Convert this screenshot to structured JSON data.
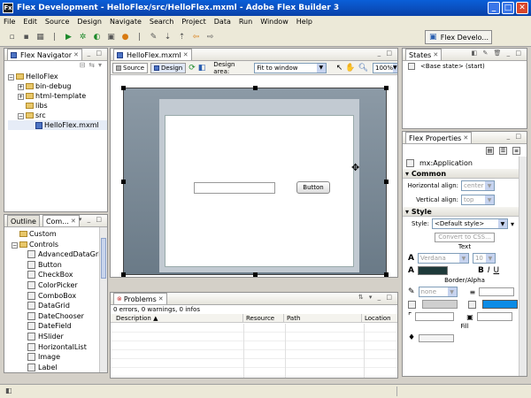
{
  "window": {
    "title": "Flex Development - HelloFlex/src/HelloFlex.mxml - Adobe Flex Builder 3",
    "min": "_",
    "max": "□",
    "close": "✕"
  },
  "menu": [
    "File",
    "Edit",
    "Source",
    "Design",
    "Navigate",
    "Search",
    "Project",
    "Data",
    "Run",
    "Window",
    "Help"
  ],
  "perspective": {
    "label": "Flex Develo..."
  },
  "navigator": {
    "tab": "Flex Navigator",
    "tree": [
      {
        "label": "HelloFlex",
        "indent": 0,
        "exp": "−",
        "kind": "folder"
      },
      {
        "label": "bin-debug",
        "indent": 1,
        "exp": "+",
        "kind": "folder"
      },
      {
        "label": "html-template",
        "indent": 1,
        "exp": "+",
        "kind": "folder"
      },
      {
        "label": "libs",
        "indent": 1,
        "exp": "",
        "kind": "folder"
      },
      {
        "label": "src",
        "indent": 1,
        "exp": "−",
        "kind": "folder"
      },
      {
        "label": "HelloFlex.mxml",
        "indent": 2,
        "exp": "",
        "kind": "file"
      }
    ]
  },
  "components": {
    "tabs": [
      "Outline",
      "Com..."
    ],
    "items": [
      {
        "label": "Custom",
        "kind": "folder",
        "indent": 0,
        "exp": ""
      },
      {
        "label": "Controls",
        "kind": "folder",
        "indent": 0,
        "exp": "−"
      },
      {
        "label": "AdvancedDataGrid",
        "indent": 1
      },
      {
        "label": "Button",
        "indent": 1
      },
      {
        "label": "CheckBox",
        "indent": 1
      },
      {
        "label": "ColorPicker",
        "indent": 1
      },
      {
        "label": "ComboBox",
        "indent": 1
      },
      {
        "label": "DataGrid",
        "indent": 1
      },
      {
        "label": "DateChooser",
        "indent": 1
      },
      {
        "label": "DateField",
        "indent": 1
      },
      {
        "label": "HSlider",
        "indent": 1
      },
      {
        "label": "HorizontalList",
        "indent": 1
      },
      {
        "label": "Image",
        "indent": 1
      },
      {
        "label": "Label",
        "indent": 1
      }
    ]
  },
  "editor": {
    "tab": "HelloFlex.mxml",
    "source_label": "Source",
    "design_label": "Design",
    "design_area_label": "Design area:",
    "design_area_value": "Fit to window",
    "zoom": "100%",
    "canvas_button": "Button"
  },
  "problems": {
    "tab": "Problems",
    "summary": "0 errors, 0 warnings, 0 infos",
    "columns": [
      "Description",
      "Resource",
      "Path",
      "Location"
    ]
  },
  "states": {
    "tab": "States",
    "item": "<Base state> (start)"
  },
  "properties": {
    "tab": "Flex Properties",
    "component": "mx:Application",
    "common_title": "Common",
    "halign_label": "Horizontal align:",
    "halign_value": "center",
    "valign_label": "Vertical align:",
    "valign_value": "top",
    "style_title": "Style",
    "style_label": "Style:",
    "style_value": "<Default style>",
    "convert_label": "Convert to CSS...",
    "text_title": "Text",
    "font_value": "Verdana",
    "size_value": "10",
    "border_title": "Border/Alpha",
    "border_value": "none",
    "fill_title": "Fill"
  }
}
